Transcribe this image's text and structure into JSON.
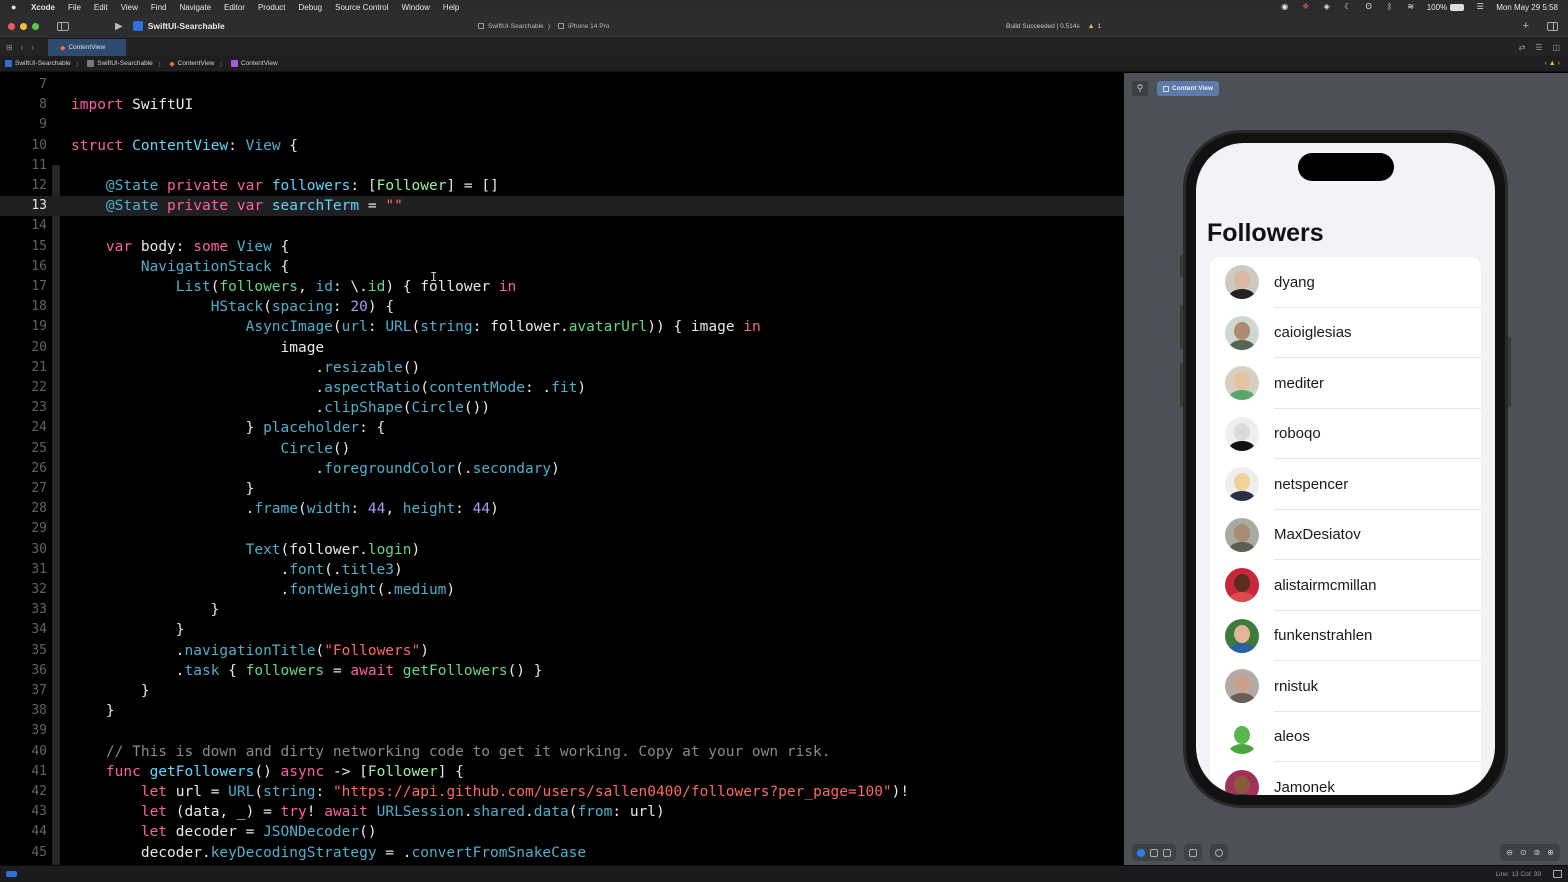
{
  "menubar": {
    "apple": "",
    "items": [
      "Xcode",
      "File",
      "Edit",
      "View",
      "Find",
      "Navigate",
      "Editor",
      "Product",
      "Debug",
      "Source Control",
      "Window",
      "Help"
    ],
    "battery": "100%",
    "clock": "Mon May 29  5:58",
    "status_icons": [
      "record-icon",
      "dropbox-icon",
      "layers-icon",
      "moon-icon",
      "hearing-icon",
      "bluetooth-icon",
      "wifi-icon",
      "battery-icon",
      "control-center-icon"
    ]
  },
  "toolbar": {
    "run_icon": "▶",
    "scheme": "SwiftUI-Searchable",
    "destination_scheme": "SwiftUI-Searchable",
    "destination_device": "iPhone 14 Pro",
    "build_status": "Build Succeeded | 0.514s",
    "warning_count": "1",
    "add_icon": "+"
  },
  "tabbar": {
    "active_tab": "ContentView"
  },
  "breadcrumb": {
    "items": [
      "SwiftUI-Searchable",
      "SwiftUI-Searchable",
      "ContentView",
      "ContentView"
    ],
    "separator": "〉"
  },
  "editor": {
    "current_line": 13,
    "lines": [
      {
        "n": "7",
        "html": ""
      },
      {
        "n": "8",
        "html": "<span class='kw'>import</span> SwiftUI"
      },
      {
        "n": "9",
        "html": ""
      },
      {
        "n": "10",
        "html": "<span class='kw'>struct</span> <span class='ty'>ContentView</span>: <span class='tyb'>View</span> {"
      },
      {
        "n": "11",
        "html": ""
      },
      {
        "n": "12",
        "html": "    <span class='attr'>@State</span> <span class='kw'>private</span> <span class='kw'>var</span> <span class='ty'>followers</span>: [<span class='idg'>Follower</span>] = []"
      },
      {
        "n": "13",
        "html": "    <span class='attr'>@State</span> <span class='kw'>private</span> <span class='kw'>var</span> <span class='ty'>searchTerm</span> = <span class='str'>\"\"</span>"
      },
      {
        "n": "14",
        "html": ""
      },
      {
        "n": "15",
        "html": "    <span class='kw'>var</span> body: <span class='kw'>some</span> <span class='tyb'>View</span> {"
      },
      {
        "n": "16",
        "html": "        <span class='tyb'>NavigationStack</span> {"
      },
      {
        "n": "17",
        "html": "            <span class='tyb'>List</span>(<span class='tg'>followers</span>, <span class='mblue'>id</span>: \\.<span class='tg'>id</span>) { follower <span class='kw'>in</span>"
      },
      {
        "n": "18",
        "html": "                <span class='tyb'>HStack</span>(<span class='mblue'>spacing</span>: <span class='num'>20</span>) {"
      },
      {
        "n": "19",
        "html": "                    <span class='tyb'>AsyncImage</span>(<span class='mblue'>url</span>: <span class='tyb'>URL</span>(<span class='mblue'>string</span>: follower.<span class='tg'>avatarUrl</span>)) { image <span class='kw'>in</span>"
      },
      {
        "n": "20",
        "html": "                        image"
      },
      {
        "n": "21",
        "html": "                            .<span class='mblue'>resizable</span>()"
      },
      {
        "n": "22",
        "html": "                            .<span class='mblue'>aspectRatio</span>(<span class='mblue'>contentMode</span>: .<span class='mblue'>fit</span>)"
      },
      {
        "n": "23",
        "html": "                            .<span class='mblue'>clipShape</span>(<span class='tyb'>Circle</span>())"
      },
      {
        "n": "24",
        "html": "                    } <span class='mblue'>placeholder</span>: {"
      },
      {
        "n": "25",
        "html": "                        <span class='tyb'>Circle</span>()"
      },
      {
        "n": "26",
        "html": "                            .<span class='mblue'>foregroundColor</span>(.<span class='mblue'>secondary</span>)"
      },
      {
        "n": "27",
        "html": "                    }"
      },
      {
        "n": "28",
        "html": "                    .<span class='mblue'>frame</span>(<span class='mblue'>width</span>: <span class='num'>44</span>, <span class='mblue'>height</span>: <span class='num'>44</span>)"
      },
      {
        "n": "29",
        "html": ""
      },
      {
        "n": "30",
        "html": "                    <span class='tyb'>Text</span>(follower.<span class='tg'>login</span>)"
      },
      {
        "n": "31",
        "html": "                        .<span class='mblue'>font</span>(.<span class='mblue'>title3</span>)"
      },
      {
        "n": "32",
        "html": "                        .<span class='mblue'>fontWeight</span>(.<span class='mblue'>medium</span>)"
      },
      {
        "n": "33",
        "html": "                }"
      },
      {
        "n": "34",
        "html": "            }"
      },
      {
        "n": "35",
        "html": "            .<span class='mblue'>navigationTitle</span>(<span class='str'>\"Followers\"</span>)"
      },
      {
        "n": "36",
        "html": "            .<span class='mblue'>task</span> { <span class='tg'>followers</span> = <span class='kw'>await</span> <span class='tg'>getFollowers</span>() }"
      },
      {
        "n": "37",
        "html": "        }"
      },
      {
        "n": "38",
        "html": "    }"
      },
      {
        "n": "39",
        "html": ""
      },
      {
        "n": "40",
        "html": "    <span class='cmt'>// This is down and dirty networking code to get it working. Copy at your own risk.</span>"
      },
      {
        "n": "41",
        "html": "    <span class='kw'>func</span> <span class='ty'>getFollowers</span>() <span class='kw'>async</span> -&gt; [<span class='idg'>Follower</span>] {"
      },
      {
        "n": "42",
        "html": "        <span class='kw'>let</span> url = <span class='tyb'>URL</span>(<span class='mblue'>string</span>: <span class='str'>\"https://api.github.com/users/sallen0400/followers?per_page=100\"</span>)!"
      },
      {
        "n": "43",
        "html": "        <span class='kw'>let</span> (data, _) = <span class='kw'>try</span>! <span class='kw'>await</span> <span class='tyb'>URLSession</span>.<span class='mblue'>shared</span>.<span class='mblue'>data</span>(<span class='mblue'>from</span>: url)"
      },
      {
        "n": "44",
        "html": "        <span class='kw'>let</span> decoder = <span class='tyb'>JSONDecoder</span>()"
      },
      {
        "n": "45",
        "html": "        decoder.<span class='mblue'>keyDecodingStrategy</span> = .<span class='mblue'>convertFromSnakeCase</span>"
      }
    ]
  },
  "preview": {
    "pin_icon": "📌",
    "tab_label": "Content View",
    "nav_title": "Followers",
    "followers": [
      {
        "login": "dyang",
        "face": "#d9b8a0",
        "bg": "#cfc9c4",
        "shirt": "#222222"
      },
      {
        "login": "caioiglesias",
        "face": "#b08a70",
        "bg": "#cfd8d0",
        "shirt": "#556655"
      },
      {
        "login": "mediter",
        "face": "#e7c49f",
        "bg": "#d6cfc2",
        "shirt": "#59a86b"
      },
      {
        "login": "roboqo",
        "face": "#dcdcdc",
        "bg": "#efefef",
        "shirt": "#111111"
      },
      {
        "login": "netspencer",
        "face": "#f1d29b",
        "bg": "#eeeeee",
        "shirt": "#2b2e45"
      },
      {
        "login": "MaxDesiatov",
        "face": "#a88b70",
        "bg": "#a7aba3",
        "shirt": "#5a5f52"
      },
      {
        "login": "alistairmcmillan",
        "face": "#5a2d20",
        "bg": "#c8263b",
        "shirt": "#e04a4a"
      },
      {
        "login": "funkenstrahlen",
        "face": "#e2b59a",
        "bg": "#3d7a3b",
        "shirt": "#2e5fa4"
      },
      {
        "login": "rnistuk",
        "face": "#caa08a",
        "bg": "#b3aaa5",
        "shirt": "#6b5f59"
      },
      {
        "login": "aleos",
        "face": "#58b84e",
        "bg": "#ffffff",
        "shirt": "#4aa63f"
      },
      {
        "login": "Jamonek",
        "face": "#8a5a3c",
        "bg": "#a0325a",
        "shirt": "#333333"
      }
    ]
  },
  "canvas_controls": {
    "zoom_icons": [
      "zoom-out-icon",
      "zoom-100-icon",
      "zoom-fit-icon",
      "zoom-in-icon"
    ]
  },
  "statusbar": {
    "position": "Line: 13  Col: 39"
  }
}
